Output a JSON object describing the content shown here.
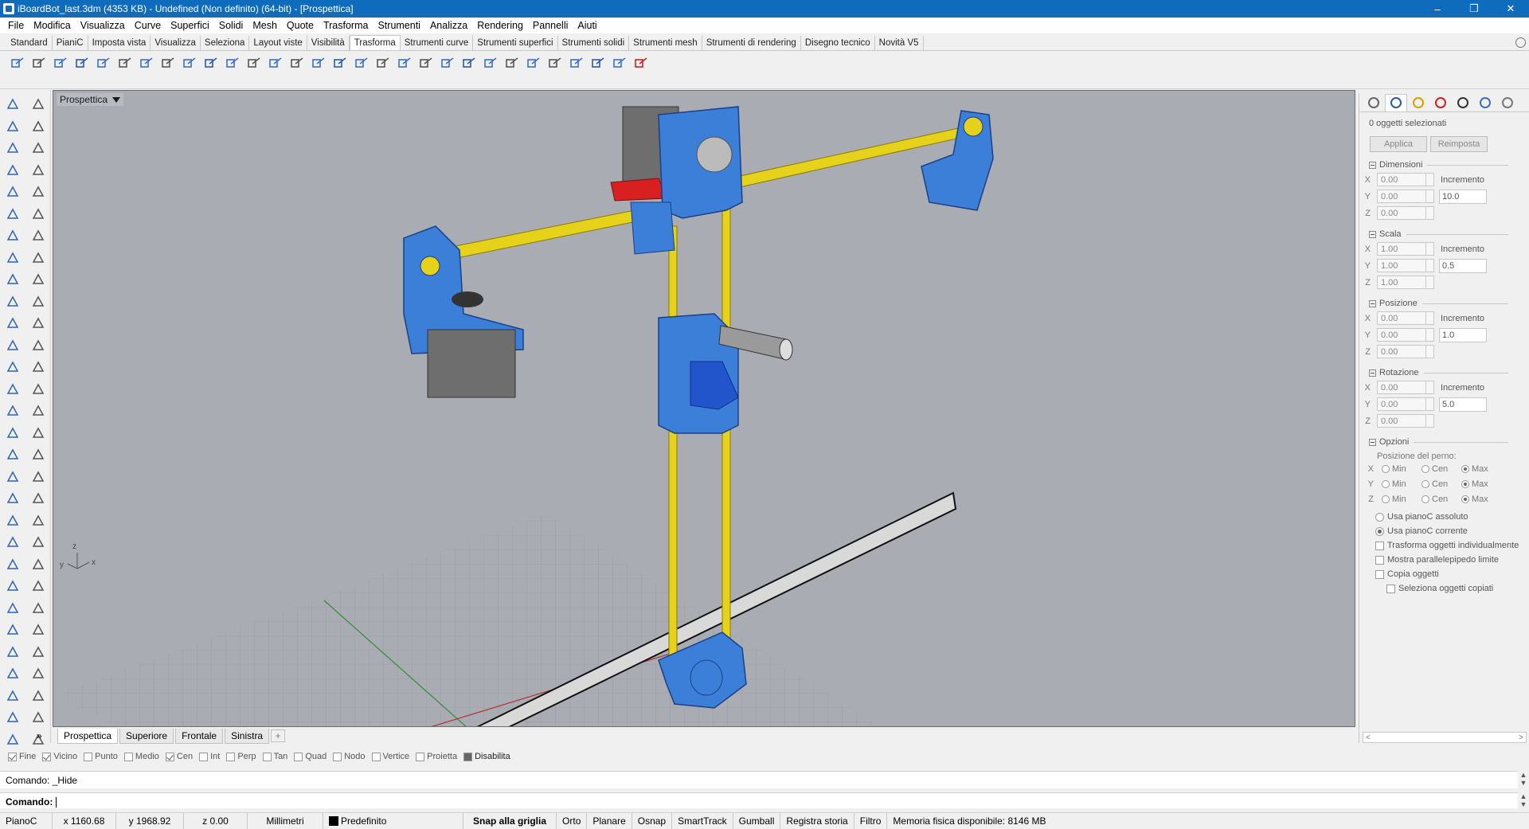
{
  "window": {
    "title": "iBoardBot_last.3dm (4353 KB) - Undefined (Non definito) (64-bit) - [Prospettica]",
    "controls": [
      "–",
      "❐",
      "✕"
    ]
  },
  "menu": [
    "File",
    "Modifica",
    "Visualizza",
    "Curve",
    "Superfici",
    "Solidi",
    "Mesh",
    "Quote",
    "Trasforma",
    "Strumenti",
    "Analizza",
    "Rendering",
    "Pannelli",
    "Aiuti"
  ],
  "toolbar_tabs": [
    "Standard",
    "PianiC",
    "Imposta vista",
    "Visualizza",
    "Seleziona",
    "Layout viste",
    "Visibilità",
    "Trasforma",
    "Strumenti curve",
    "Strumenti superfici",
    "Strumenti solidi",
    "Strumenti mesh",
    "Strumenti di rendering",
    "Disegno tecnico",
    "Novità V5"
  ],
  "active_toolbar_tab": "Trasforma",
  "viewport": {
    "label": "Prospettica",
    "axis_labels": {
      "z": "z",
      "y": "y",
      "x": "x"
    }
  },
  "view_tabs": [
    "Prospettica",
    "Superiore",
    "Frontale",
    "Sinistra"
  ],
  "more_symbol": "»",
  "panel": {
    "selected": "0 oggetti selezionati",
    "apply": "Applica",
    "reset": "Reimposta",
    "sections": [
      {
        "title": "Dimensioni",
        "rows": [
          {
            "axis": "X",
            "value": "0.00"
          },
          {
            "axis": "Y",
            "value": "0.00"
          },
          {
            "axis": "Z",
            "value": "0.00"
          }
        ],
        "inc_label": "Incremento",
        "inc_value": "10.0"
      },
      {
        "title": "Scala",
        "rows": [
          {
            "axis": "X",
            "value": "1.00"
          },
          {
            "axis": "Y",
            "value": "1.00"
          },
          {
            "axis": "Z",
            "value": "1.00"
          }
        ],
        "inc_label": "Incremento",
        "inc_value": "0.5"
      },
      {
        "title": "Posizione",
        "rows": [
          {
            "axis": "X",
            "value": "0.00"
          },
          {
            "axis": "Y",
            "value": "0.00"
          },
          {
            "axis": "Z",
            "value": "0.00"
          }
        ],
        "inc_label": "Incremento",
        "inc_value": "1.0"
      },
      {
        "title": "Rotazione",
        "rows": [
          {
            "axis": "X",
            "value": "0.00"
          },
          {
            "axis": "Y",
            "value": "0.00"
          },
          {
            "axis": "Z",
            "value": "0.00"
          }
        ],
        "inc_label": "Incremento",
        "inc_value": "5.0"
      }
    ],
    "options": {
      "title": "Opzioni",
      "pivot_label": "Posizione del perno:",
      "pivot_rows": [
        {
          "axis": "X",
          "selected": "Max"
        },
        {
          "axis": "Y",
          "selected": "Max"
        },
        {
          "axis": "Z",
          "selected": "Max"
        }
      ],
      "pivot_choices": [
        "Min",
        "Cen",
        "Max"
      ],
      "radio1": "Usa pianoC assoluto",
      "radio2": "Usa pianoC corrente",
      "check1": "Trasforma oggetti individualmente",
      "check2": "Mostra parallelepipedo limite",
      "check3": "Copia oggetti",
      "check4": "Seleziona oggetti copiati"
    }
  },
  "osnaps": [
    {
      "label": "Fine",
      "checked": true
    },
    {
      "label": "Vicino",
      "checked": true
    },
    {
      "label": "Punto",
      "checked": false
    },
    {
      "label": "Medio",
      "checked": false
    },
    {
      "label": "Cen",
      "checked": true
    },
    {
      "label": "Int",
      "checked": false
    },
    {
      "label": "Perp",
      "checked": false
    },
    {
      "label": "Tan",
      "checked": false
    },
    {
      "label": "Quad",
      "checked": false
    },
    {
      "label": "Nodo",
      "checked": false
    },
    {
      "label": "Vertice",
      "checked": false
    },
    {
      "label": "Proietta",
      "checked": false
    },
    {
      "label": "Disabilita",
      "checked": false,
      "disabled_style": true
    }
  ],
  "command": {
    "history": "Comando: _Hide",
    "prompt": "Comando:"
  },
  "status": {
    "plane": "PianoC",
    "x": "x 1160.68",
    "y": "y 1968.92",
    "z": "z 0.00",
    "units": "Millimetri",
    "layer": "Predefinito",
    "grid_snap": "Snap alla griglia",
    "ortho": "Orto",
    "planar": "Planare",
    "osnap": "Osnap",
    "smarttrack": "SmartTrack",
    "gumball": "Gumball",
    "history": "Registra storia",
    "filter": "Filtro",
    "memory": "Memoria fisica disponibile: 8146 MB"
  },
  "colors": {
    "titlebar": "#0f6cbd",
    "viewport_bg": "#a9adb3",
    "selected_part": "#3b7fd9",
    "rod": "#e6d21a",
    "motor": "#6e6e6e",
    "red_part": "#d92020"
  }
}
